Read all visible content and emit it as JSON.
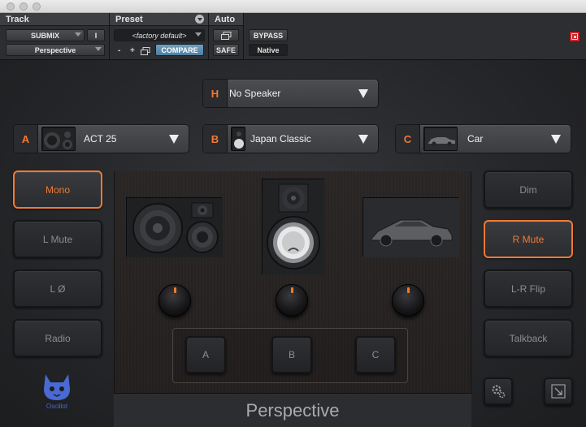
{
  "header": {
    "track": {
      "title": "Track",
      "channel": "SUBMIX",
      "channel_mode": "I",
      "plugin": "Perspective"
    },
    "preset": {
      "title": "Preset",
      "name": "<factory default>",
      "minus": "-",
      "plus": "+",
      "compare": "COMPARE"
    },
    "auto": {
      "title": "Auto",
      "safe": "SAFE"
    },
    "bypass": "BYPASS",
    "format": "Native"
  },
  "speakers": {
    "h": {
      "letter": "H",
      "label": "No Speaker"
    },
    "a": {
      "letter": "A",
      "label": "ACT 25"
    },
    "b": {
      "letter": "B",
      "label": "Japan Classic"
    },
    "c": {
      "letter": "C",
      "label": "Car"
    }
  },
  "left_buttons": [
    "Mono",
    "L Mute",
    "L Ø",
    "Radio"
  ],
  "right_buttons": [
    "Dim",
    "R Mute",
    "L-R Flip",
    "Talkback"
  ],
  "active": {
    "mono": true,
    "r_mute": true
  },
  "select_buttons": [
    "A",
    "B",
    "C"
  ],
  "brand": {
    "name": "Perspective",
    "logo_text": "Oscillot"
  },
  "colors": {
    "accent": "#f07a33",
    "logo": "#4a6ad3"
  }
}
